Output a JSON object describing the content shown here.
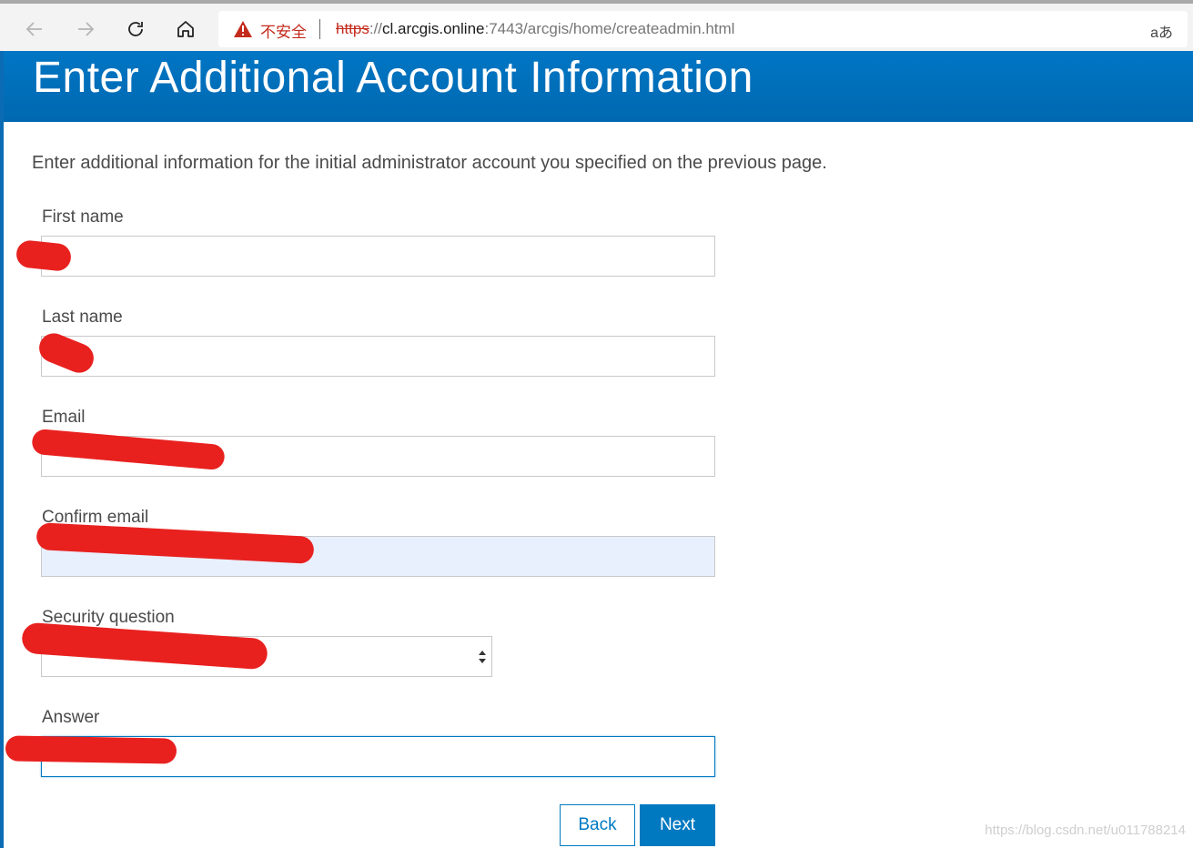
{
  "browser": {
    "security_label": "不安全",
    "url_scheme": "https",
    "url_sep": "://",
    "url_host": "cl.arcgis.online",
    "url_rest": ":7443/arcgis/home/createadmin.html",
    "translate_glyph": "aあ"
  },
  "page": {
    "title": "Enter Additional Account Information",
    "intro": "Enter additional information for the initial administrator account you specified on the previous page."
  },
  "form": {
    "first_name_label": "First name",
    "last_name_label": "Last name",
    "email_label": "Email",
    "confirm_email_label": "Confirm email",
    "security_question_label": "Security question",
    "answer_label": "Answer"
  },
  "buttons": {
    "back": "Back",
    "next": "Next"
  },
  "watermark": "https://blog.csdn.net/u011788214",
  "colors": {
    "brand_blue": "#0079c1",
    "redaction_red": "#e8211f"
  }
}
